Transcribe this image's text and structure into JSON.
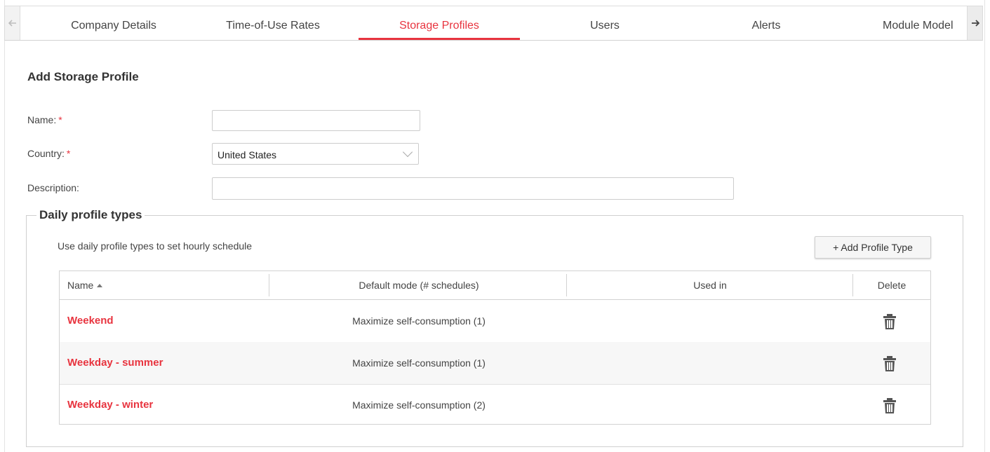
{
  "tabs": {
    "items": [
      {
        "label": "Company Details",
        "active": false
      },
      {
        "label": "Time-of-Use Rates",
        "active": false
      },
      {
        "label": "Storage Profiles",
        "active": true
      },
      {
        "label": "Users",
        "active": false
      },
      {
        "label": "Alerts",
        "active": false
      },
      {
        "label": "Module Model",
        "active": false
      }
    ],
    "scroll_left_icon": "arrow-left-icon",
    "scroll_right_icon": "arrow-right-icon"
  },
  "form": {
    "title": "Add Storage Profile",
    "required_marker": "*",
    "name": {
      "label": "Name:",
      "value": "",
      "placeholder": ""
    },
    "country": {
      "label": "Country:",
      "value": "United States"
    },
    "description": {
      "label": "Description:",
      "value": "",
      "placeholder": ""
    }
  },
  "profile_types": {
    "legend": "Daily profile types",
    "hint": "Use daily profile types to set hourly schedule",
    "add_button": "+ Add Profile Type",
    "columns": [
      "Name",
      "Default mode (# schedules)",
      "Used in",
      "Delete"
    ],
    "sort_column": "Name",
    "sort_direction": "ascending",
    "rows": [
      {
        "name": "Weekend",
        "mode": "Maximize self-consumption (1)",
        "used_in": ""
      },
      {
        "name": "Weekday - summer",
        "mode": "Maximize self-consumption (1)",
        "used_in": ""
      },
      {
        "name": "Weekday - winter",
        "mode": "Maximize self-consumption (2)",
        "used_in": ""
      }
    ],
    "delete_icon": "trash-icon"
  },
  "colors": {
    "accent": "#e8343f",
    "border": "#cccccc",
    "text": "#333333"
  }
}
